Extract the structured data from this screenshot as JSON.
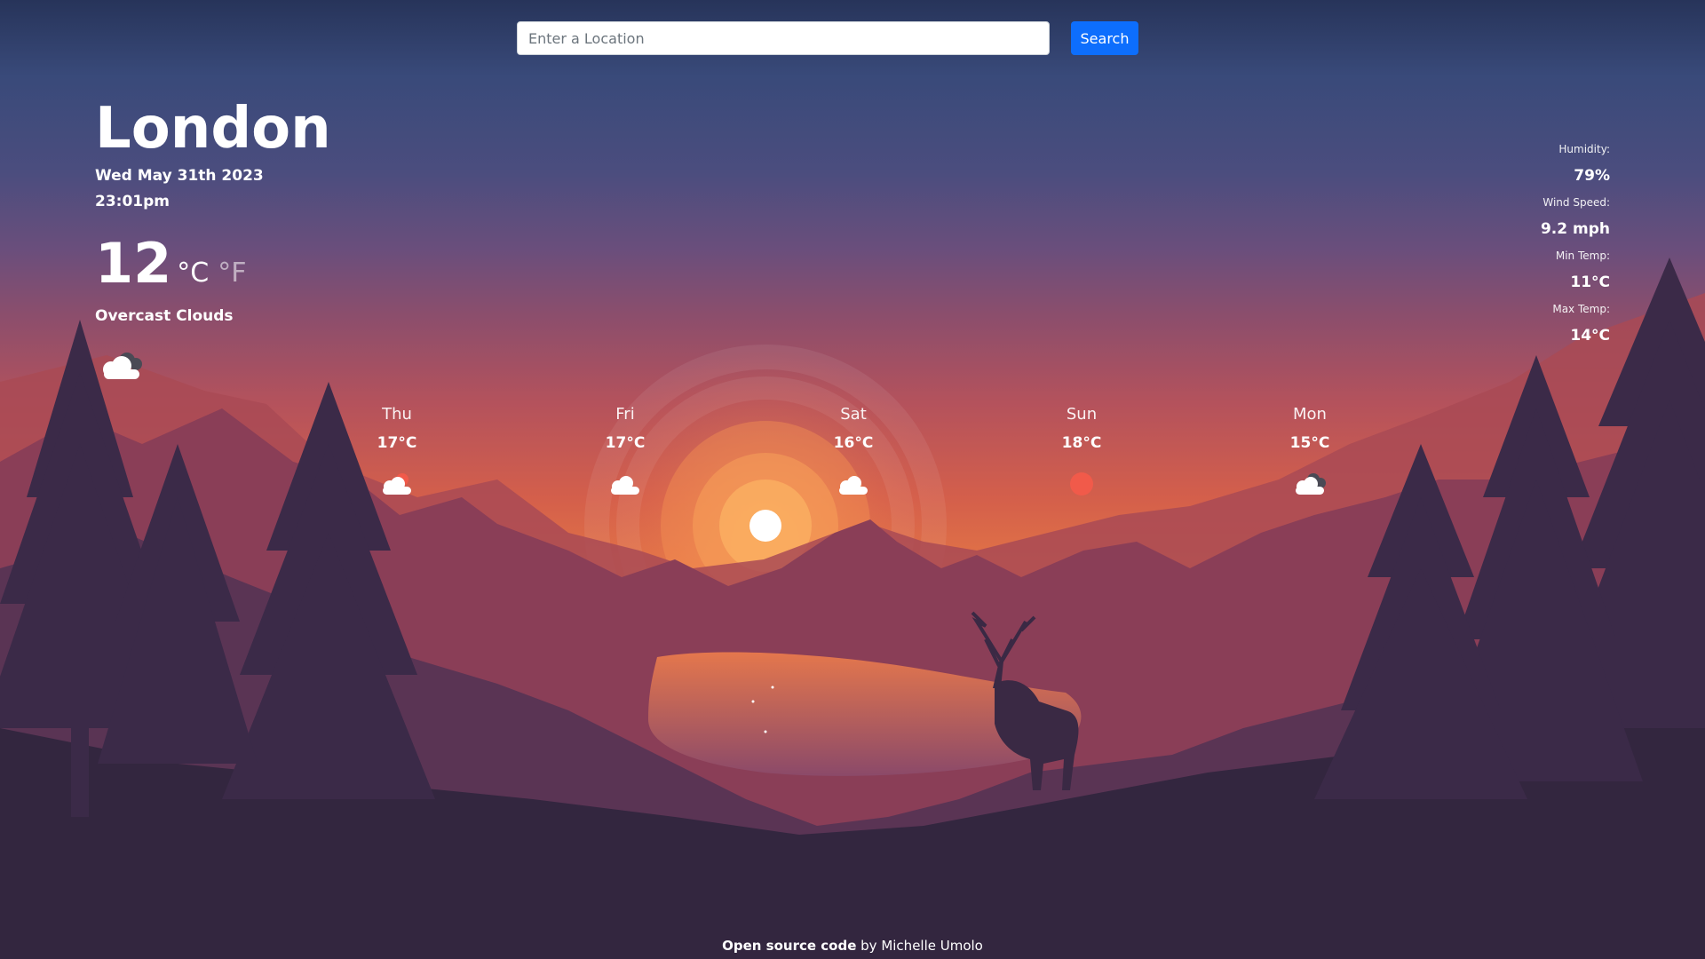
{
  "search": {
    "placeholder": "Enter a Location",
    "button_label": "Search"
  },
  "current": {
    "city": "London",
    "date": "Wed May 31th 2023",
    "time": "23:01pm",
    "temperature": "12",
    "unit_c": "°C",
    "unit_f": "°F",
    "description": "Overcast Clouds",
    "icon": "overcast-clouds-icon"
  },
  "details": [
    {
      "label": "Humidity:",
      "value": "79%"
    },
    {
      "label": "Wind Speed:",
      "value": "9.2 mph"
    },
    {
      "label": "Min Temp:",
      "value": "11°C"
    },
    {
      "label": "Max Temp:",
      "value": "14°C"
    }
  ],
  "forecast": [
    {
      "day": "Thu",
      "temp": "17°C",
      "icon": "partly-cloudy-sun-icon"
    },
    {
      "day": "Fri",
      "temp": "17°C",
      "icon": "cloud-icon"
    },
    {
      "day": "Sat",
      "temp": "16°C",
      "icon": "cloud-icon"
    },
    {
      "day": "Sun",
      "temp": "18°C",
      "icon": "sun-icon"
    },
    {
      "day": "Mon",
      "temp": "15°C",
      "icon": "overcast-clouds-icon"
    }
  ],
  "footer": {
    "link_text": "Open source code",
    "suffix": " by Michelle Umolo"
  },
  "colors": {
    "search_button": "#0d6efd",
    "sun": "#f15a4a"
  }
}
